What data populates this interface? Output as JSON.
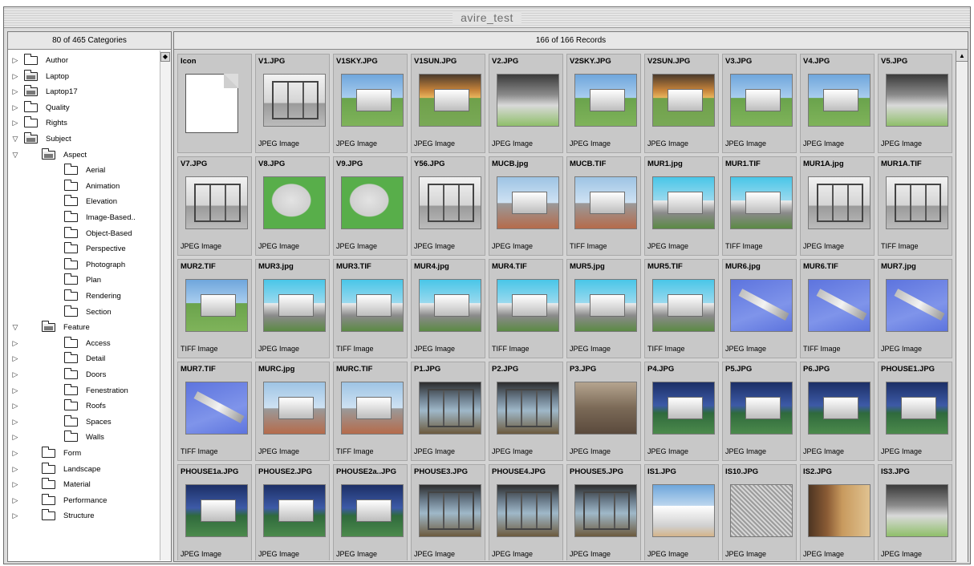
{
  "window": {
    "title": "avire_test"
  },
  "left_panel": {
    "header": "80 of 465 Categories",
    "tree": [
      {
        "label": "Author",
        "level": 0,
        "open": false,
        "expander": "right"
      },
      {
        "label": "Laptop",
        "level": 0,
        "open": true,
        "expander": "right"
      },
      {
        "label": "Laptop17",
        "level": 0,
        "open": true,
        "expander": "right"
      },
      {
        "label": "Quality",
        "level": 0,
        "open": false,
        "expander": "right"
      },
      {
        "label": "Rights",
        "level": 0,
        "open": false,
        "expander": "right"
      },
      {
        "label": "Subject",
        "level": 0,
        "open": true,
        "expander": "down"
      },
      {
        "label": "Aspect",
        "level": 1,
        "open": true,
        "expander": "down"
      },
      {
        "label": "Aerial",
        "level": 2,
        "open": false,
        "expander": "none"
      },
      {
        "label": "Animation",
        "level": 2,
        "open": false,
        "expander": "none"
      },
      {
        "label": "Elevation",
        "level": 2,
        "open": false,
        "expander": "none"
      },
      {
        "label": "Image-Based..",
        "level": 2,
        "open": false,
        "expander": "none"
      },
      {
        "label": "Object-Based",
        "level": 2,
        "open": false,
        "expander": "none"
      },
      {
        "label": "Perspective",
        "level": 2,
        "open": false,
        "expander": "none"
      },
      {
        "label": "Photograph",
        "level": 2,
        "open": false,
        "expander": "none"
      },
      {
        "label": "Plan",
        "level": 2,
        "open": false,
        "expander": "none"
      },
      {
        "label": "Rendering",
        "level": 2,
        "open": false,
        "expander": "none"
      },
      {
        "label": "Section",
        "level": 2,
        "open": false,
        "expander": "none"
      },
      {
        "label": "Feature",
        "level": 1,
        "open": true,
        "expander": "down"
      },
      {
        "label": "Access",
        "level": 2,
        "open": false,
        "expander": "right"
      },
      {
        "label": "Detail",
        "level": 2,
        "open": false,
        "expander": "right"
      },
      {
        "label": "Doors",
        "level": 2,
        "open": false,
        "expander": "right"
      },
      {
        "label": "Fenestration",
        "level": 2,
        "open": false,
        "expander": "right"
      },
      {
        "label": "Roofs",
        "level": 2,
        "open": false,
        "expander": "right"
      },
      {
        "label": "Spaces",
        "level": 2,
        "open": false,
        "expander": "right"
      },
      {
        "label": "Walls",
        "level": 2,
        "open": false,
        "expander": "right"
      },
      {
        "label": "Form",
        "level": 1,
        "open": false,
        "expander": "right"
      },
      {
        "label": "Landscape",
        "level": 1,
        "open": false,
        "expander": "right"
      },
      {
        "label": "Material",
        "level": 1,
        "open": false,
        "expander": "right"
      },
      {
        "label": "Performance",
        "level": 1,
        "open": false,
        "expander": "right"
      },
      {
        "label": "Structure",
        "level": 1,
        "open": false,
        "expander": "right"
      }
    ]
  },
  "right_panel": {
    "header": "166 of 166 Records",
    "records": [
      {
        "name": "Icon",
        "type": "",
        "thumb": "icon"
      },
      {
        "name": "V1.JPG",
        "type": "JPEG Image",
        "thumb": "interior"
      },
      {
        "name": "V1SKY.JPG",
        "type": "JPEG Image",
        "thumb": "sky"
      },
      {
        "name": "V1SUN.JPG",
        "type": "JPEG Image",
        "thumb": "sunset"
      },
      {
        "name": "V2.JPG",
        "type": "JPEG Image",
        "thumb": "render"
      },
      {
        "name": "V2SKY.JPG",
        "type": "JPEG Image",
        "thumb": "sky"
      },
      {
        "name": "V2SUN.JPG",
        "type": "JPEG Image",
        "thumb": "sunset"
      },
      {
        "name": "V3.JPG",
        "type": "JPEG Image",
        "thumb": "sky"
      },
      {
        "name": "V4.JPG",
        "type": "JPEG Image",
        "thumb": "sky"
      },
      {
        "name": "V5.JPG",
        "type": "JPEG Image",
        "thumb": "render"
      },
      {
        "name": "V7.JPG",
        "type": "JPEG Image",
        "thumb": "interior"
      },
      {
        "name": "V8.JPG",
        "type": "JPEG Image",
        "thumb": "plan"
      },
      {
        "name": "V9.JPG",
        "type": "JPEG Image",
        "thumb": "plan"
      },
      {
        "name": "Y56.JPG",
        "type": "JPEG Image",
        "thumb": "interior"
      },
      {
        "name": "MUCB.jpg",
        "type": "JPEG Image",
        "thumb": "street"
      },
      {
        "name": "MUCB.TIF",
        "type": "TIFF Image",
        "thumb": "street"
      },
      {
        "name": "MUR1.jpg",
        "type": "JPEG Image",
        "thumb": "cyan"
      },
      {
        "name": "MUR1.TIF",
        "type": "TIFF Image",
        "thumb": "cyan"
      },
      {
        "name": "MUR1A.jpg",
        "type": "JPEG Image",
        "thumb": "interior"
      },
      {
        "name": "MUR1A.TIF",
        "type": "TIFF Image",
        "thumb": "interior"
      },
      {
        "name": "MUR2.TIF",
        "type": "TIFF Image",
        "thumb": "sky"
      },
      {
        "name": "MUR3.jpg",
        "type": "JPEG Image",
        "thumb": "cyan"
      },
      {
        "name": "MUR3.TIF",
        "type": "TIFF Image",
        "thumb": "cyan"
      },
      {
        "name": "MUR4.jpg",
        "type": "JPEG Image",
        "thumb": "cyan"
      },
      {
        "name": "MUR4.TIF",
        "type": "TIFF Image",
        "thumb": "cyan"
      },
      {
        "name": "MUR5.jpg",
        "type": "JPEG Image",
        "thumb": "cyan"
      },
      {
        "name": "MUR5.TIF",
        "type": "TIFF Image",
        "thumb": "cyan"
      },
      {
        "name": "MUR6.jpg",
        "type": "JPEG Image",
        "thumb": "blue"
      },
      {
        "name": "MUR6.TIF",
        "type": "TIFF Image",
        "thumb": "blue"
      },
      {
        "name": "MUR7.jpg",
        "type": "JPEG Image",
        "thumb": "blue"
      },
      {
        "name": "MUR7.TIF",
        "type": "TIFF Image",
        "thumb": "blue"
      },
      {
        "name": "MURC.jpg",
        "type": "JPEG Image",
        "thumb": "street"
      },
      {
        "name": "MURC.TIF",
        "type": "TIFF Image",
        "thumb": "street"
      },
      {
        "name": "P1.JPG",
        "type": "JPEG Image",
        "thumb": "glass"
      },
      {
        "name": "P2.JPG",
        "type": "JPEG Image",
        "thumb": "glass"
      },
      {
        "name": "P3.JPG",
        "type": "JPEG Image",
        "thumb": "hall"
      },
      {
        "name": "P4.JPG",
        "type": "JPEG Image",
        "thumb": "night"
      },
      {
        "name": "P5.JPG",
        "type": "JPEG Image",
        "thumb": "night"
      },
      {
        "name": "P6.JPG",
        "type": "JPEG Image",
        "thumb": "night"
      },
      {
        "name": "PHOUSE1.JPG",
        "type": "JPEG Image",
        "thumb": "night"
      },
      {
        "name": "PHOUSE1a.JPG",
        "type": "JPEG Image",
        "thumb": "night"
      },
      {
        "name": "PHOUSE2.JPG",
        "type": "JPEG Image",
        "thumb": "night"
      },
      {
        "name": "PHOUSE2a..JPG",
        "type": "JPEG Image",
        "thumb": "night"
      },
      {
        "name": "PHOUSE3.JPG",
        "type": "JPEG Image",
        "thumb": "glass"
      },
      {
        "name": "PHOUSE4.JPG",
        "type": "JPEG Image",
        "thumb": "glass"
      },
      {
        "name": "PHOUSE5.JPG",
        "type": "JPEG Image",
        "thumb": "glass"
      },
      {
        "name": "IS1.JPG",
        "type": "JPEG Image",
        "thumb": "facade"
      },
      {
        "name": "IS10.JPG",
        "type": "JPEG Image",
        "thumb": "mesh"
      },
      {
        "name": "IS2.JPG",
        "type": "JPEG Image",
        "thumb": "stair"
      },
      {
        "name": "IS3.JPG",
        "type": "JPEG Image",
        "thumb": "render"
      }
    ]
  },
  "icons": {
    "tree_collapsed": "triangle-right-icon",
    "tree_expanded": "triangle-down-icon",
    "folder": "folder-icon",
    "scroll_up": "scroll-up-arrow-icon"
  },
  "colors": {
    "window_bg": "#dcdcdc",
    "cell_bg": "#c8c8c8",
    "panel_header_bg": "#e7e7e7"
  }
}
